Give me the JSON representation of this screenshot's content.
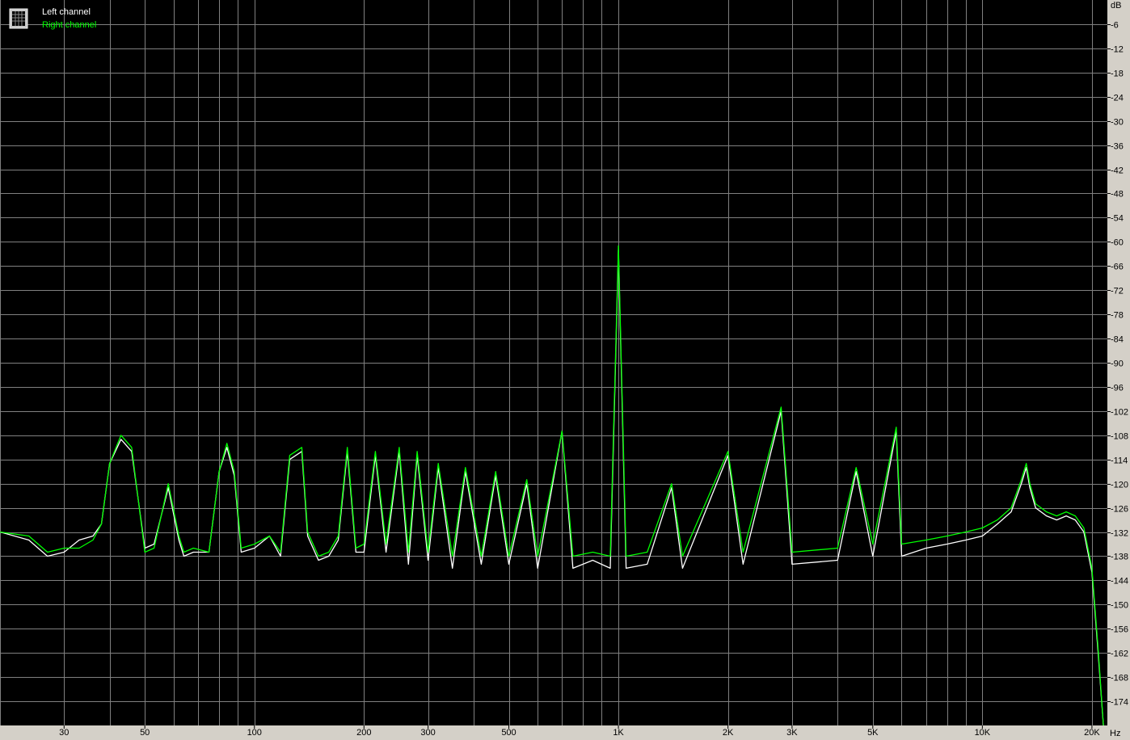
{
  "chart_data": {
    "type": "line",
    "x_scale": "log",
    "xlim": [
      20,
      22050
    ],
    "ylim": [
      -180,
      0
    ],
    "y_unit": "dB",
    "x_unit": "Hz",
    "grid": true,
    "legend_position": "top-left",
    "y_ticks": [
      -6,
      -12,
      -18,
      -24,
      -30,
      -36,
      -42,
      -48,
      -54,
      -60,
      -66,
      -72,
      -78,
      -84,
      -90,
      -96,
      -102,
      -108,
      -114,
      -120,
      -126,
      -132,
      -138,
      -144,
      -150,
      -156,
      -162,
      -168,
      -174
    ],
    "x_ticks": [
      {
        "value": 30,
        "label": "30"
      },
      {
        "value": 50,
        "label": "50"
      },
      {
        "value": 100,
        "label": "100"
      },
      {
        "value": 200,
        "label": "200"
      },
      {
        "value": 300,
        "label": "300"
      },
      {
        "value": 500,
        "label": "500"
      },
      {
        "value": 1000,
        "label": "1K"
      },
      {
        "value": 2000,
        "label": "2K"
      },
      {
        "value": 3000,
        "label": "3K"
      },
      {
        "value": 5000,
        "label": "5K"
      },
      {
        "value": 10000,
        "label": "10K"
      },
      {
        "value": 20000,
        "label": "20K"
      }
    ],
    "colors": {
      "background": "#000000",
      "grid": "#808080",
      "left": "#ffffff",
      "right": "#00ff00"
    },
    "series": [
      {
        "name": "Left channel",
        "color": "#ffffff",
        "points": [
          [
            20,
            -132
          ],
          [
            24,
            -134
          ],
          [
            27,
            -138
          ],
          [
            30,
            -137
          ],
          [
            33,
            -134
          ],
          [
            36,
            -133
          ],
          [
            38,
            -130
          ],
          [
            40,
            -115
          ],
          [
            43,
            -109
          ],
          [
            46,
            -112
          ],
          [
            50,
            -136
          ],
          [
            53,
            -135
          ],
          [
            58,
            -121
          ],
          [
            62,
            -134
          ],
          [
            64,
            -138
          ],
          [
            68,
            -137
          ],
          [
            75,
            -137
          ],
          [
            80,
            -117
          ],
          [
            84,
            -111
          ],
          [
            88,
            -118
          ],
          [
            92,
            -137
          ],
          [
            100,
            -136
          ],
          [
            110,
            -133
          ],
          [
            118,
            -138
          ],
          [
            125,
            -114
          ],
          [
            135,
            -112
          ],
          [
            140,
            -133
          ],
          [
            150,
            -139
          ],
          [
            160,
            -138
          ],
          [
            170,
            -134
          ],
          [
            180,
            -112
          ],
          [
            190,
            -137
          ],
          [
            200,
            -137
          ],
          [
            215,
            -113
          ],
          [
            230,
            -137
          ],
          [
            250,
            -112
          ],
          [
            265,
            -140
          ],
          [
            280,
            -113
          ],
          [
            300,
            -139
          ],
          [
            320,
            -116
          ],
          [
            350,
            -141
          ],
          [
            380,
            -117
          ],
          [
            420,
            -140
          ],
          [
            460,
            -118
          ],
          [
            500,
            -140
          ],
          [
            560,
            -120
          ],
          [
            600,
            -141
          ],
          [
            700,
            -107
          ],
          [
            750,
            -141
          ],
          [
            850,
            -139
          ],
          [
            950,
            -141
          ],
          [
            1000,
            -62
          ],
          [
            1050,
            -141
          ],
          [
            1200,
            -140
          ],
          [
            1400,
            -121
          ],
          [
            1500,
            -141
          ],
          [
            2000,
            -113
          ],
          [
            2200,
            -140
          ],
          [
            2800,
            -102
          ],
          [
            3000,
            -140
          ],
          [
            4000,
            -139
          ],
          [
            4500,
            -117
          ],
          [
            5000,
            -138
          ],
          [
            5800,
            -107
          ],
          [
            6000,
            -138
          ],
          [
            7000,
            -136
          ],
          [
            8000,
            -135
          ],
          [
            9000,
            -134
          ],
          [
            10000,
            -133
          ],
          [
            11000,
            -130
          ],
          [
            12000,
            -127
          ],
          [
            12800,
            -120
          ],
          [
            13200,
            -116
          ],
          [
            13500,
            -121
          ],
          [
            14000,
            -126
          ],
          [
            15000,
            -128
          ],
          [
            16000,
            -129
          ],
          [
            17000,
            -128
          ],
          [
            18000,
            -129
          ],
          [
            19000,
            -132
          ],
          [
            20000,
            -142
          ],
          [
            20800,
            -162
          ],
          [
            21500,
            -180
          ]
        ]
      },
      {
        "name": "Right channel",
        "color": "#00ff00",
        "points": [
          [
            20,
            -132
          ],
          [
            24,
            -133
          ],
          [
            27,
            -137
          ],
          [
            30,
            -136
          ],
          [
            33,
            -136
          ],
          [
            36,
            -134
          ],
          [
            38,
            -130
          ],
          [
            40,
            -115
          ],
          [
            43,
            -108
          ],
          [
            46,
            -111
          ],
          [
            50,
            -137
          ],
          [
            53,
            -136
          ],
          [
            58,
            -120
          ],
          [
            62,
            -133
          ],
          [
            64,
            -137
          ],
          [
            68,
            -136
          ],
          [
            75,
            -137
          ],
          [
            80,
            -117
          ],
          [
            84,
            -110
          ],
          [
            88,
            -117
          ],
          [
            92,
            -136
          ],
          [
            100,
            -135
          ],
          [
            110,
            -133
          ],
          [
            118,
            -137
          ],
          [
            125,
            -113
          ],
          [
            135,
            -111
          ],
          [
            140,
            -132
          ],
          [
            150,
            -138
          ],
          [
            160,
            -137
          ],
          [
            170,
            -133
          ],
          [
            180,
            -111
          ],
          [
            190,
            -136
          ],
          [
            200,
            -135
          ],
          [
            215,
            -112
          ],
          [
            230,
            -135
          ],
          [
            250,
            -111
          ],
          [
            265,
            -137
          ],
          [
            280,
            -112
          ],
          [
            300,
            -137
          ],
          [
            320,
            -115
          ],
          [
            350,
            -138
          ],
          [
            380,
            -116
          ],
          [
            420,
            -138
          ],
          [
            460,
            -117
          ],
          [
            500,
            -138
          ],
          [
            560,
            -119
          ],
          [
            600,
            -138
          ],
          [
            700,
            -107
          ],
          [
            750,
            -138
          ],
          [
            850,
            -137
          ],
          [
            950,
            -138
          ],
          [
            1000,
            -61
          ],
          [
            1050,
            -138
          ],
          [
            1200,
            -137
          ],
          [
            1400,
            -120
          ],
          [
            1500,
            -138
          ],
          [
            2000,
            -112
          ],
          [
            2200,
            -137
          ],
          [
            2800,
            -101
          ],
          [
            3000,
            -137
          ],
          [
            4000,
            -136
          ],
          [
            4500,
            -116
          ],
          [
            5000,
            -135
          ],
          [
            5800,
            -106
          ],
          [
            6000,
            -135
          ],
          [
            7000,
            -134
          ],
          [
            8000,
            -133
          ],
          [
            9000,
            -132
          ],
          [
            10000,
            -131
          ],
          [
            11000,
            -129
          ],
          [
            12000,
            -126
          ],
          [
            12800,
            -119
          ],
          [
            13200,
            -115
          ],
          [
            13500,
            -120
          ],
          [
            14000,
            -125
          ],
          [
            15000,
            -127
          ],
          [
            16000,
            -128
          ],
          [
            17000,
            -127
          ],
          [
            18000,
            -128
          ],
          [
            19000,
            -131
          ],
          [
            20000,
            -141
          ],
          [
            20800,
            -161
          ],
          [
            21500,
            -180
          ]
        ]
      }
    ]
  }
}
